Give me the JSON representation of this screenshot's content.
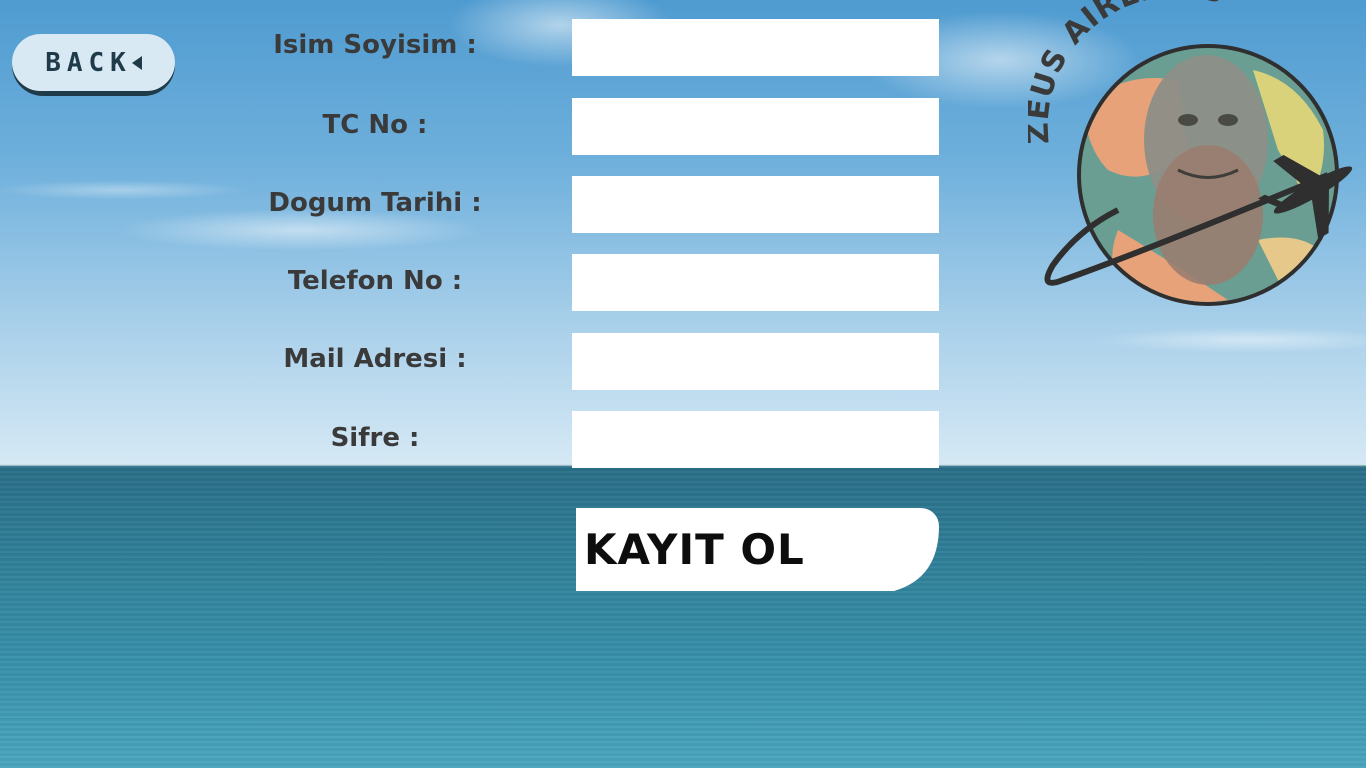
{
  "nav": {
    "back_label": "BACK"
  },
  "form": {
    "fields": [
      {
        "label": "Isim Soyisim :",
        "value": ""
      },
      {
        "label": "TC No :",
        "value": ""
      },
      {
        "label": "Dogum Tarihi :",
        "value": ""
      },
      {
        "label": "Telefon No :",
        "value": ""
      },
      {
        "label": "Mail Adresi :",
        "value": ""
      },
      {
        "label": "Sifre :",
        "value": ""
      }
    ],
    "submit_label": "KAYIT OL"
  },
  "logo": {
    "text": "ZEUS AIRLINES"
  },
  "colors": {
    "label_text": "#3a3a3a",
    "back_button_bg": "#d8e9f4",
    "back_button_shadow": "#1f3a48",
    "input_bg": "#ffffff"
  }
}
